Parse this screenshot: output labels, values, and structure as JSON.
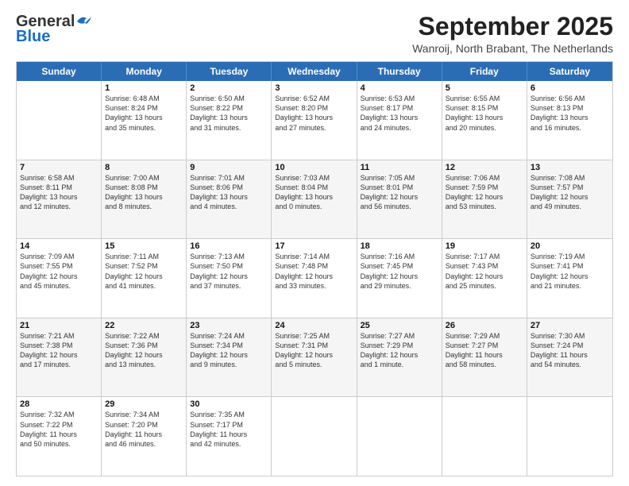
{
  "header": {
    "logo_general": "General",
    "logo_blue": "Blue",
    "month_title": "September 2025",
    "subtitle": "Wanroij, North Brabant, The Netherlands"
  },
  "days_of_week": [
    "Sunday",
    "Monday",
    "Tuesday",
    "Wednesday",
    "Thursday",
    "Friday",
    "Saturday"
  ],
  "rows": [
    [
      {
        "day": "",
        "info": ""
      },
      {
        "day": "1",
        "info": "Sunrise: 6:48 AM\nSunset: 8:24 PM\nDaylight: 13 hours\nand 35 minutes."
      },
      {
        "day": "2",
        "info": "Sunrise: 6:50 AM\nSunset: 8:22 PM\nDaylight: 13 hours\nand 31 minutes."
      },
      {
        "day": "3",
        "info": "Sunrise: 6:52 AM\nSunset: 8:20 PM\nDaylight: 13 hours\nand 27 minutes."
      },
      {
        "day": "4",
        "info": "Sunrise: 6:53 AM\nSunset: 8:17 PM\nDaylight: 13 hours\nand 24 minutes."
      },
      {
        "day": "5",
        "info": "Sunrise: 6:55 AM\nSunset: 8:15 PM\nDaylight: 13 hours\nand 20 minutes."
      },
      {
        "day": "6",
        "info": "Sunrise: 6:56 AM\nSunset: 8:13 PM\nDaylight: 13 hours\nand 16 minutes."
      }
    ],
    [
      {
        "day": "7",
        "info": "Sunrise: 6:58 AM\nSunset: 8:11 PM\nDaylight: 13 hours\nand 12 minutes."
      },
      {
        "day": "8",
        "info": "Sunrise: 7:00 AM\nSunset: 8:08 PM\nDaylight: 13 hours\nand 8 minutes."
      },
      {
        "day": "9",
        "info": "Sunrise: 7:01 AM\nSunset: 8:06 PM\nDaylight: 13 hours\nand 4 minutes."
      },
      {
        "day": "10",
        "info": "Sunrise: 7:03 AM\nSunset: 8:04 PM\nDaylight: 13 hours\nand 0 minutes."
      },
      {
        "day": "11",
        "info": "Sunrise: 7:05 AM\nSunset: 8:01 PM\nDaylight: 12 hours\nand 56 minutes."
      },
      {
        "day": "12",
        "info": "Sunrise: 7:06 AM\nSunset: 7:59 PM\nDaylight: 12 hours\nand 53 minutes."
      },
      {
        "day": "13",
        "info": "Sunrise: 7:08 AM\nSunset: 7:57 PM\nDaylight: 12 hours\nand 49 minutes."
      }
    ],
    [
      {
        "day": "14",
        "info": "Sunrise: 7:09 AM\nSunset: 7:55 PM\nDaylight: 12 hours\nand 45 minutes."
      },
      {
        "day": "15",
        "info": "Sunrise: 7:11 AM\nSunset: 7:52 PM\nDaylight: 12 hours\nand 41 minutes."
      },
      {
        "day": "16",
        "info": "Sunrise: 7:13 AM\nSunset: 7:50 PM\nDaylight: 12 hours\nand 37 minutes."
      },
      {
        "day": "17",
        "info": "Sunrise: 7:14 AM\nSunset: 7:48 PM\nDaylight: 12 hours\nand 33 minutes."
      },
      {
        "day": "18",
        "info": "Sunrise: 7:16 AM\nSunset: 7:45 PM\nDaylight: 12 hours\nand 29 minutes."
      },
      {
        "day": "19",
        "info": "Sunrise: 7:17 AM\nSunset: 7:43 PM\nDaylight: 12 hours\nand 25 minutes."
      },
      {
        "day": "20",
        "info": "Sunrise: 7:19 AM\nSunset: 7:41 PM\nDaylight: 12 hours\nand 21 minutes."
      }
    ],
    [
      {
        "day": "21",
        "info": "Sunrise: 7:21 AM\nSunset: 7:38 PM\nDaylight: 12 hours\nand 17 minutes."
      },
      {
        "day": "22",
        "info": "Sunrise: 7:22 AM\nSunset: 7:36 PM\nDaylight: 12 hours\nand 13 minutes."
      },
      {
        "day": "23",
        "info": "Sunrise: 7:24 AM\nSunset: 7:34 PM\nDaylight: 12 hours\nand 9 minutes."
      },
      {
        "day": "24",
        "info": "Sunrise: 7:25 AM\nSunset: 7:31 PM\nDaylight: 12 hours\nand 5 minutes."
      },
      {
        "day": "25",
        "info": "Sunrise: 7:27 AM\nSunset: 7:29 PM\nDaylight: 12 hours\nand 1 minute."
      },
      {
        "day": "26",
        "info": "Sunrise: 7:29 AM\nSunset: 7:27 PM\nDaylight: 11 hours\nand 58 minutes."
      },
      {
        "day": "27",
        "info": "Sunrise: 7:30 AM\nSunset: 7:24 PM\nDaylight: 11 hours\nand 54 minutes."
      }
    ],
    [
      {
        "day": "28",
        "info": "Sunrise: 7:32 AM\nSunset: 7:22 PM\nDaylight: 11 hours\nand 50 minutes."
      },
      {
        "day": "29",
        "info": "Sunrise: 7:34 AM\nSunset: 7:20 PM\nDaylight: 11 hours\nand 46 minutes."
      },
      {
        "day": "30",
        "info": "Sunrise: 7:35 AM\nSunset: 7:17 PM\nDaylight: 11 hours\nand 42 minutes."
      },
      {
        "day": "",
        "info": ""
      },
      {
        "day": "",
        "info": ""
      },
      {
        "day": "",
        "info": ""
      },
      {
        "day": "",
        "info": ""
      }
    ]
  ]
}
